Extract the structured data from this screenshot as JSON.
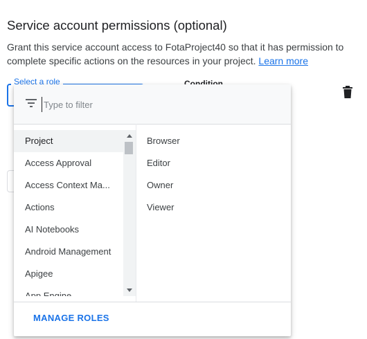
{
  "section": {
    "title": "Service account permissions (optional)",
    "description": "Grant this service account access to FotaProject40 so that it has permission to complete specific actions on the resources in your project.",
    "learn_more": "Learn more"
  },
  "role_field": {
    "label": "Select a role"
  },
  "condition": {
    "label": "Condition"
  },
  "dropdown": {
    "filter_placeholder": "Type to filter",
    "categories": [
      "Project",
      "Access Approval",
      "Access Context Ma...",
      "Actions",
      "AI Notebooks",
      "Android Management",
      "Apigee",
      "App Engine"
    ],
    "selected_category": "Project",
    "roles": [
      "Browser",
      "Editor",
      "Owner",
      "Viewer"
    ],
    "manage_roles": "MANAGE ROLES"
  },
  "icons": {
    "trash": "trash-icon",
    "filter": "filter-icon"
  },
  "colors": {
    "accent": "#1a73e8",
    "text": "#202124"
  }
}
